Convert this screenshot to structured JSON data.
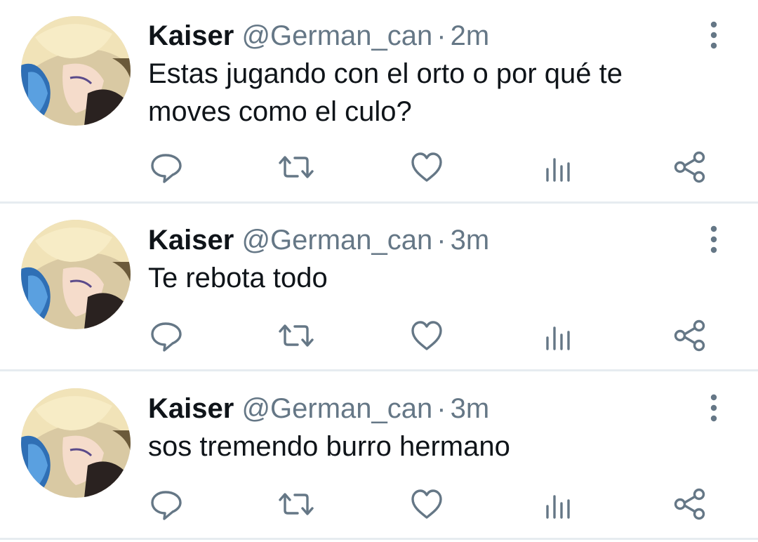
{
  "tweets": [
    {
      "name": "Kaiser",
      "handle": "@German_can",
      "separator": "·",
      "time": "2m",
      "text": "Estas jugando con el orto o por qué te moves como el culo?"
    },
    {
      "name": "Kaiser",
      "handle": "@German_can",
      "separator": "·",
      "time": "3m",
      "text": "Te rebota todo"
    },
    {
      "name": "Kaiser",
      "handle": "@German_can",
      "separator": "·",
      "time": "3m",
      "text": "sos tremendo burro hermano"
    }
  ],
  "icons": {
    "reply": "reply-icon",
    "retweet": "retweet-icon",
    "like": "heart-icon",
    "analytics": "analytics-icon",
    "share": "share-icon",
    "more": "more-vertical-icon"
  },
  "colors": {
    "text": "#0f1419",
    "secondary": "#657786",
    "divider": "#e6ecf0"
  }
}
